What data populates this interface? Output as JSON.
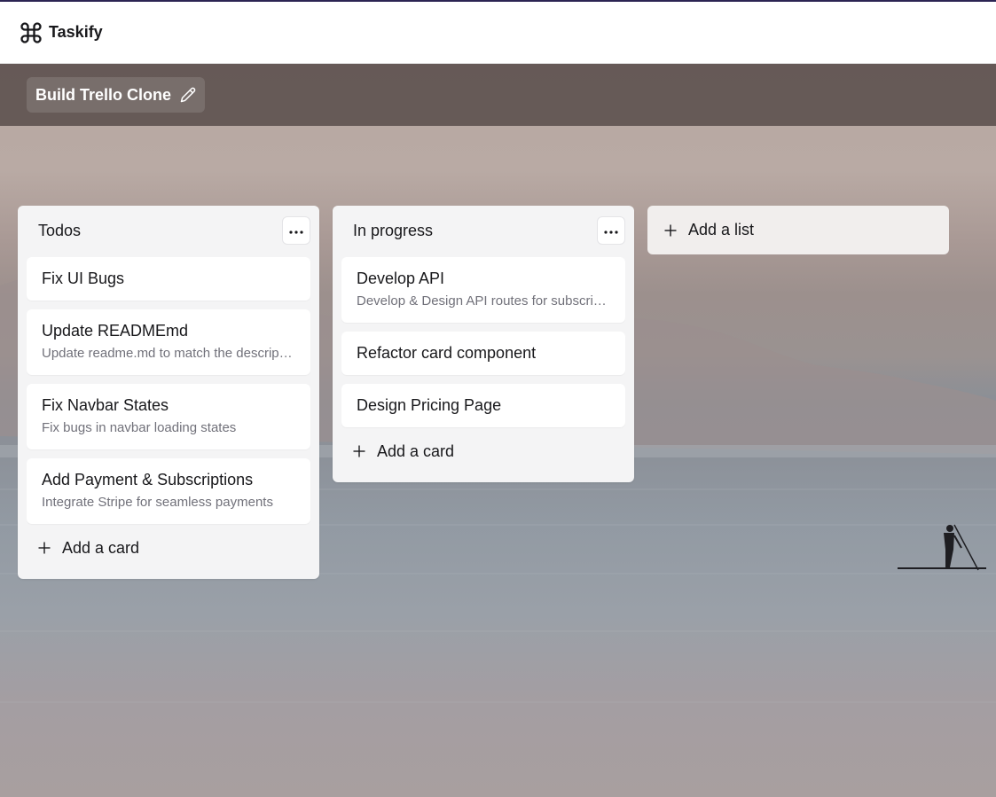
{
  "app": {
    "name": "Taskify",
    "logo_icon": "command-icon"
  },
  "board": {
    "title": "Build Trello Clone",
    "edit_icon": "pencil-icon"
  },
  "lists": [
    {
      "title": "Todos",
      "cards": [
        {
          "title": "Fix UI Bugs"
        },
        {
          "title": "Update READMEmd",
          "description": "Update readme.md to match the description"
        },
        {
          "title": "Fix Navbar States",
          "description": "Fix bugs in navbar loading states"
        },
        {
          "title": "Add Payment & Subscriptions",
          "description": "Integrate Stripe for seamless payments"
        }
      ],
      "add_card_label": "Add a card"
    },
    {
      "title": "In progress",
      "cards": [
        {
          "title": "Develop API",
          "description": "Develop & Design API routes for subscriptions"
        },
        {
          "title": "Refactor card component"
        },
        {
          "title": "Design Pricing Page"
        }
      ],
      "add_card_label": "Add a card"
    }
  ],
  "add_list_label": "Add a list",
  "colors": {
    "navbar_border": "#2b2453",
    "list_bg": "#f4f4f5",
    "card_bg": "#ffffff",
    "muted_text": "#71717a"
  }
}
